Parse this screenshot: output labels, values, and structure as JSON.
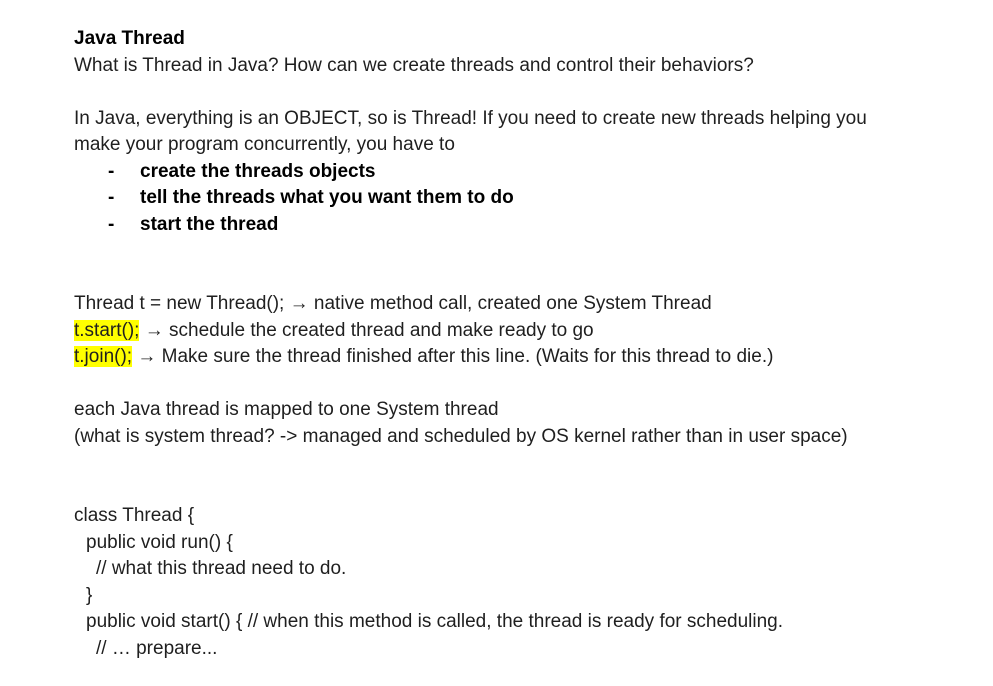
{
  "title": "Java Thread",
  "intro_question": "What is Thread in Java? How can we create threads and control their behaviors?",
  "paragraph": {
    "line1": "In Java, everything is an OBJECT, so is Thread! If you need to create new threads helping you",
    "line2": "make your program concurrently, you have to"
  },
  "bullets": [
    {
      "marker": "-",
      "text": "create the threads objects"
    },
    {
      "marker": "-",
      "text": "tell the threads what you want them to do"
    },
    {
      "marker": "-",
      "text": "start the thread"
    }
  ],
  "code_notes": [
    {
      "code": "Thread t  = new Thread();",
      "note": " → native method call, created one System Thread",
      "highlight": false
    },
    {
      "code": "t.start();",
      "note": " → schedule the created thread and make ready to go",
      "highlight": true
    },
    {
      "code": "t.join();",
      "note": " → Make sure the thread finished after this line. (Waits for this thread to die.)",
      "highlight": true
    }
  ],
  "mapping": {
    "line1": "each Java thread is mapped to one System thread",
    "line2": "(what is system thread? -> managed and scheduled by OS kernel rather than in user space)"
  },
  "class_code": [
    "class Thread {",
    "public void run() {",
    "// what this thread need to do.",
    "}",
    "public void start() { // when this method is called, the thread is ready for scheduling.",
    "// … prepare..."
  ]
}
